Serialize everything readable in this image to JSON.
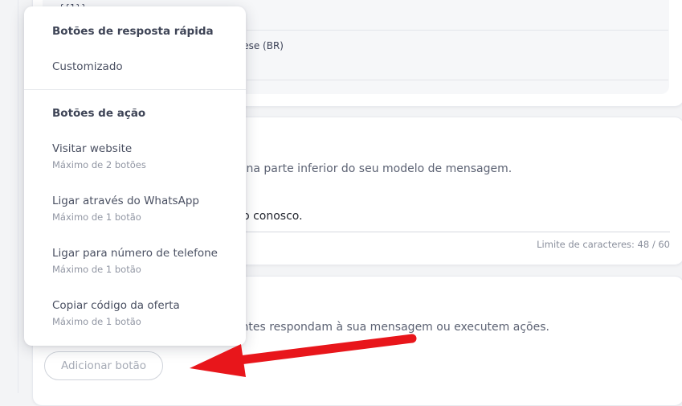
{
  "top": {
    "partial_text": "{{1}}",
    "language_partial": "guese (BR)"
  },
  "menu": {
    "quick_reply_header": "Botões de resposta rápida",
    "custom_label": "Customizado",
    "action_header": "Botões de ação",
    "items": [
      {
        "label": "Visitar website",
        "sub": "Máximo de 2 botões"
      },
      {
        "label": "Ligar através do WhatsApp",
        "sub": "Máximo de 1 botão"
      },
      {
        "label": "Ligar para número de telefone",
        "sub": "Máximo de 1 botão"
      },
      {
        "label": "Copiar código da oferta",
        "sub": "Máximo de 1 botão"
      }
    ]
  },
  "footer_section": {
    "description_partial": "to na parte inferior do seu modelo de mensagem.",
    "input_value_partial": "ato conosco.",
    "char_limit_label": "Limite de caracteres: 48 / 60"
  },
  "buttons_section": {
    "description_partial": "ientes respondam à sua mensagem ou executem ações.",
    "add_button_label": "Adicionar botão"
  },
  "annotation": {
    "arrow_color": "#e8161b"
  }
}
